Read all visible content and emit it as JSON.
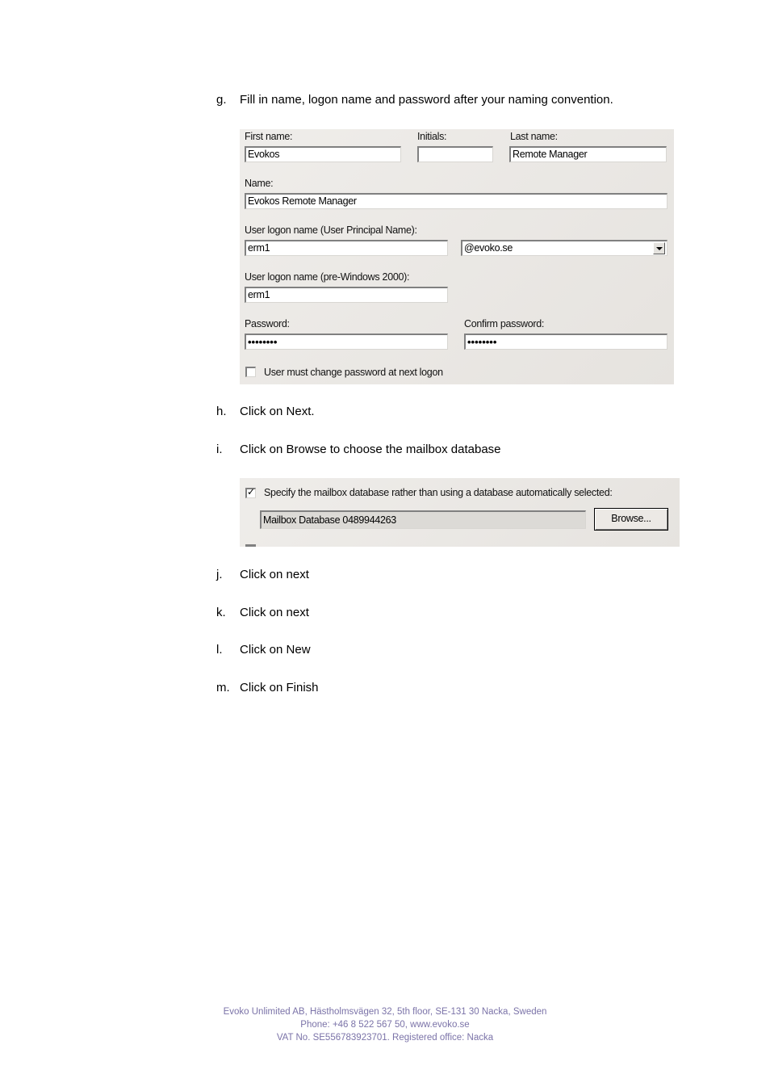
{
  "steps": [
    {
      "letter": "g.",
      "text": "Fill in name, logon name and password after your naming convention."
    },
    {
      "letter": "h.",
      "text": "Click on Next."
    },
    {
      "letter": "i.",
      "text": "Click on Browse to choose the mailbox database"
    },
    {
      "letter": "j.",
      "text": "Click on next"
    },
    {
      "letter": "k.",
      "text": "Click on next"
    },
    {
      "letter": "l.",
      "text": "Click on New"
    },
    {
      "letter": "m.",
      "text": "Click on Finish"
    }
  ],
  "user_form": {
    "first_name": {
      "label": "First name:",
      "value": "Evokos"
    },
    "initials": {
      "label": "Initials:",
      "value": ""
    },
    "last_name": {
      "label": "Last name:",
      "value": "Remote Manager"
    },
    "name": {
      "label": "Name:",
      "value": "Evokos Remote Manager"
    },
    "upn": {
      "label": "User logon name (User Principal Name):",
      "value": "erm1",
      "domain": "@evoko.se"
    },
    "pre2000": {
      "label": "User logon name (pre-Windows 2000):",
      "value": "erm1"
    },
    "password": {
      "label": "Password:",
      "value": "••••••••"
    },
    "confirm_password": {
      "label": "Confirm password:",
      "value": "••••••••"
    },
    "must_change": {
      "label": "User must change password at next logon",
      "checked": false
    }
  },
  "mailbox_form": {
    "specify": {
      "label": "Specify the mailbox database rather than using a database automatically selected:",
      "checked": true,
      "mark": "✓"
    },
    "database_value": "Mailbox Database 0489944263",
    "browse_label": "Browse..."
  },
  "footer": {
    "line1": "Evoko Unlimited AB,  Hästholmsvägen 32, 5th floor, SE-131 30 Nacka, Sweden",
    "line2": "Phone: +46 8 522 567 50,  www.evoko.se",
    "line3": "VAT No. SE556783923701. Registered office: Nacka"
  }
}
